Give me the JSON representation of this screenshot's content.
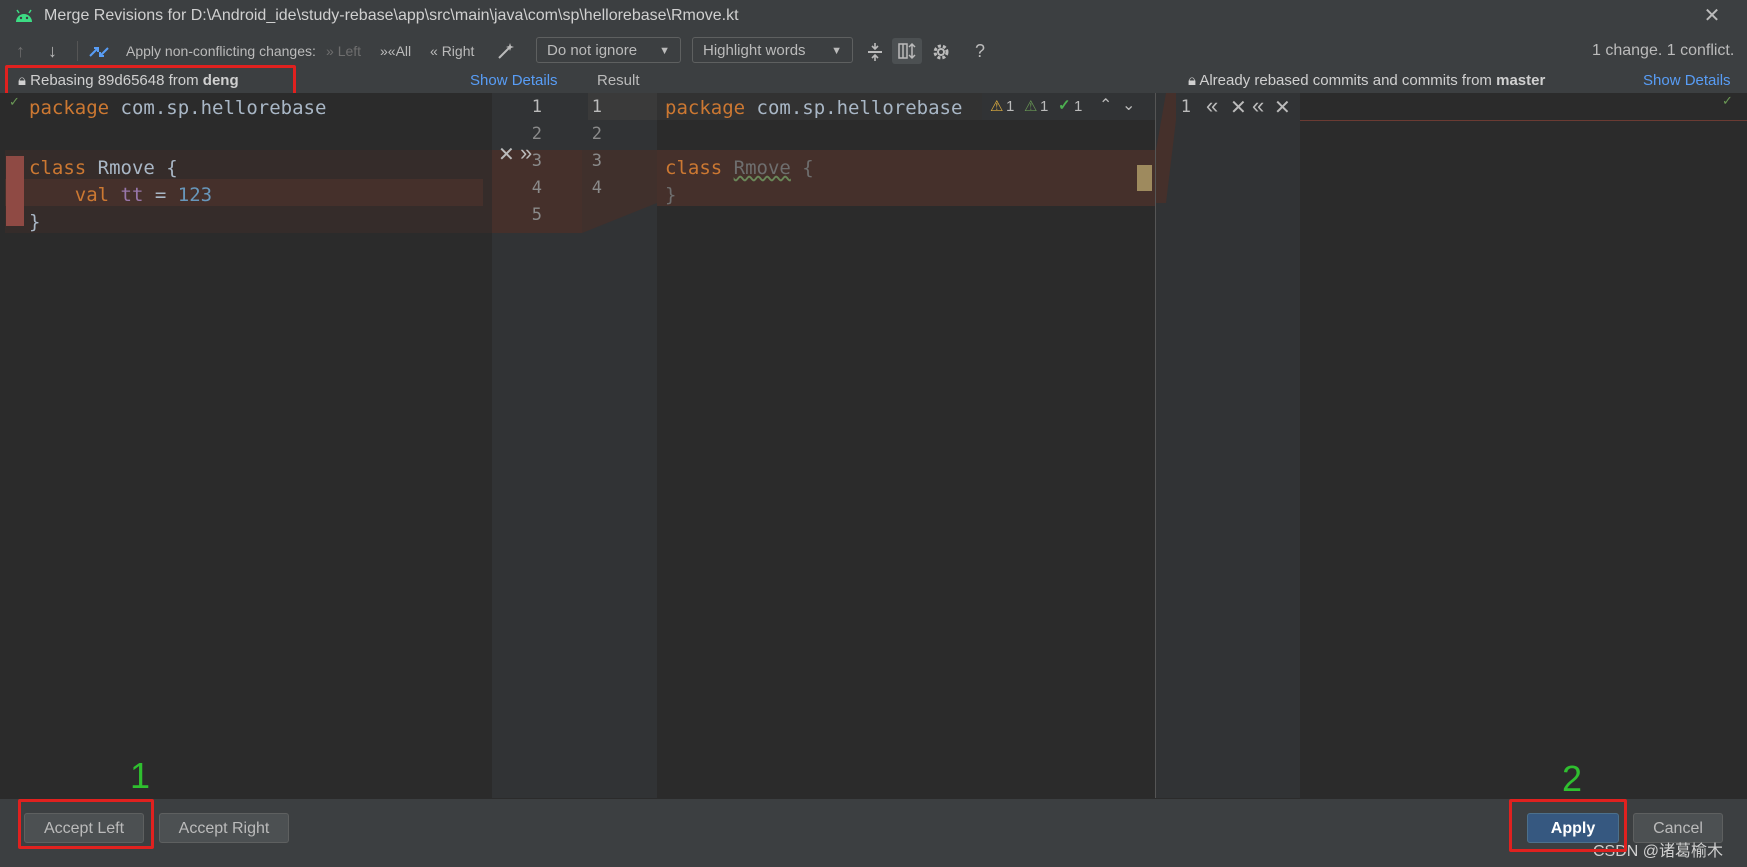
{
  "window": {
    "title": "Merge Revisions for D:\\Android_ide\\study-rebase\\app\\src\\main\\java\\com\\sp\\hellorebase\\Rmove.kt"
  },
  "toolbar": {
    "apply_non_conflicting_label": "Apply non-conflicting changes:",
    "left_label": "Left",
    "all_label": "All",
    "right_label": "Right",
    "ignore_dropdown_value": "Do not ignore",
    "highlight_dropdown_value": "Highlight words",
    "help_label": "?",
    "status": "1 change. 1 conflict."
  },
  "info": {
    "left_prefix": "Rebasing 89d65648 from",
    "left_branch": "deng",
    "left_show_details": "Show Details",
    "result_label": "Result",
    "right_prefix": "Already rebased commits and commits from",
    "right_branch": "master",
    "right_show_details": "Show Details"
  },
  "left_code": {
    "line1_kw": "package",
    "line1_rest": " com.sp.hellorebase",
    "line3_kw": "class",
    "line3_rest": " Rmove {",
    "line4_indent": "    ",
    "line4_kw": "val",
    "line4_prop": " tt",
    "line4_eq": " = ",
    "line4_num": "123",
    "line5": "}"
  },
  "mid_line_numbers": [
    "1",
    "2",
    "3",
    "4",
    "5"
  ],
  "result_line_numbers": [
    "1",
    "2",
    "3",
    "4"
  ],
  "result_code": {
    "line1_kw": "package",
    "line1_rest": " com.sp.hellorebase",
    "line3_kw": "class",
    "line3_name": "Rmove",
    "line3_brace": " {",
    "line4": "}"
  },
  "inspection_widget": {
    "warnings": "1",
    "weak_warnings": "1",
    "typos": "1"
  },
  "right_gutter": {
    "line_number": "1"
  },
  "annotations": {
    "marker1": "1",
    "marker2": "2",
    "watermark": "CSDN @诸葛榆木"
  },
  "bottom": {
    "accept_left": "Accept Left",
    "accept_right": "Accept Right",
    "apply": "Apply",
    "cancel": "Cancel"
  },
  "colors": {
    "accent_link": "#589df6",
    "annotation_red": "#e0211f",
    "annotation_green": "#2fbf2f",
    "conflict_bg": "#45302b"
  }
}
